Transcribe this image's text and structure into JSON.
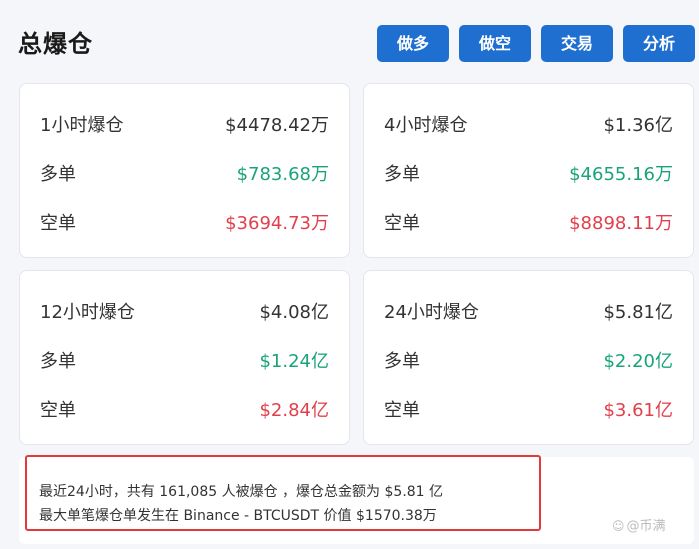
{
  "header": {
    "title": "总爆仓",
    "buttons": {
      "long": "做多",
      "short": "做空",
      "trade": "交易",
      "analysis": "分析"
    }
  },
  "cards": [
    {
      "title": "1小时爆仓",
      "total": "$4478.42万",
      "long_label": "多单",
      "long_value": "$783.68万",
      "short_label": "空单",
      "short_value": "$3694.73万"
    },
    {
      "title": "4小时爆仓",
      "total": "$1.36亿",
      "long_label": "多单",
      "long_value": "$4655.16万",
      "short_label": "空单",
      "short_value": "$8898.11万"
    },
    {
      "title": "12小时爆仓",
      "total": "$4.08亿",
      "long_label": "多单",
      "long_value": "$1.24亿",
      "short_label": "空单",
      "short_value": "$2.84亿"
    },
    {
      "title": "24小时爆仓",
      "total": "$5.81亿",
      "long_label": "多单",
      "long_value": "$2.20亿",
      "short_label": "空单",
      "short_value": "$3.61亿"
    }
  ],
  "summary": {
    "line1": "最近24小时，共有 161,085 人被爆仓 ，爆仓总金额为 $5.81 亿",
    "line2": "最大单笔爆仓单发生在 Binance - BTCUSDT 价值 $1570.38万"
  },
  "watermark": {
    "icon": "☺",
    "text": "@币满"
  },
  "colors": {
    "button": "#1f6fd0",
    "long": "#1aa37a",
    "short": "#e0404b",
    "highlight_border": "#e23a3a"
  }
}
